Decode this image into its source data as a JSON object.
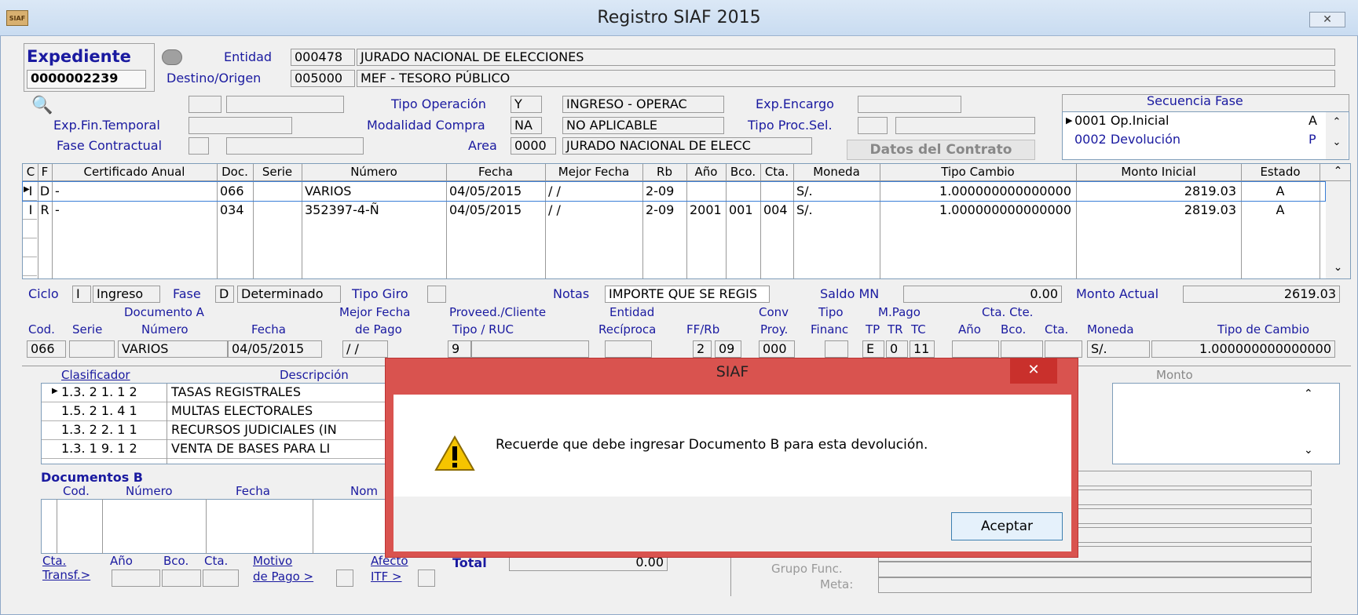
{
  "window": {
    "title": "Registro SIAF 2015",
    "icon_text": "SIAF",
    "close_glyph": "✕"
  },
  "expediente": {
    "label": "Expediente",
    "number": "0000002239"
  },
  "entidad": {
    "label": "Entidad",
    "code": "000478",
    "name": "JURADO NACIONAL DE ELECCIONES"
  },
  "destino": {
    "label": "Destino/Origen",
    "code": "005000",
    "name": "MEF - TESORO PÚBLICO"
  },
  "form": {
    "exp_fin_temporal": "Exp.Fin.Temporal",
    "fase_contractual": "Fase Contractual",
    "tipo_operacion_label": "Tipo Operación",
    "tipo_operacion_code": "Y",
    "tipo_operacion_text": "INGRESO - OPERAC",
    "modalidad_label": "Modalidad Compra",
    "modalidad_code": "NA",
    "modalidad_text": "NO APLICABLE",
    "area_label": "Area",
    "area_code": "0000",
    "area_text": "JURADO NACIONAL DE ELECC",
    "exp_encargo": "Exp.Encargo",
    "tipo_proc_sel": "Tipo Proc.Sel.",
    "datos_contrato": "Datos del Contrato"
  },
  "secuencia": {
    "title": "Secuencia Fase",
    "rows": [
      {
        "code": "0001",
        "name": "Op.Inicial",
        "st": "A"
      },
      {
        "code": "0002",
        "name": "Devolución",
        "st": "P"
      }
    ]
  },
  "grid": {
    "headers": [
      "C",
      "F",
      "Certificado Anual",
      "Doc.",
      "Serie",
      "Número",
      "Fecha",
      "Mejor Fecha",
      "Rb",
      "Año",
      "Bco.",
      "Cta.",
      "Moneda",
      "Tipo Cambio",
      "Monto Inicial",
      "Estado"
    ],
    "rows": [
      [
        "I",
        "D",
        "-",
        "066",
        "",
        "VARIOS",
        "04/05/2015",
        "/ /",
        "2-09",
        "",
        "",
        "",
        "S/.",
        "1.000000000000000",
        "2819.03",
        "A"
      ],
      [
        "I",
        "R",
        "-",
        "034",
        "",
        "352397-4-Ñ",
        "04/05/2015",
        "/ /",
        "2-09",
        "2001",
        "001",
        "004",
        "S/.",
        "1.000000000000000",
        "2819.03",
        "A"
      ]
    ]
  },
  "ciclo": {
    "ciclo_label": "Ciclo",
    "ciclo_code": "I",
    "ciclo_text": "Ingreso",
    "fase_label": "Fase",
    "fase_code": "D",
    "fase_text": "Determinado",
    "tipo_giro": "Tipo Giro",
    "notas_label": "Notas",
    "notas_text": "IMPORTE QUE SE REGIS",
    "saldo_label": "Saldo MN",
    "saldo_value": "0.00",
    "monto_label": "Monto Actual",
    "monto_value": "2619.03"
  },
  "docA": {
    "group_doc": "Documento A",
    "group_mejor": "Mejor Fecha",
    "mejor2": "de Pago",
    "group_prov": "Proveed./Cliente",
    "prov2": "Tipo / RUC",
    "group_ent": "Entidad",
    "ent2": "Recíproca",
    "ffrb": "FF/Rb",
    "conv": "Conv",
    "conv2": "Proy.",
    "tipo": "Tipo",
    "tipo2": "Financ",
    "mpago": "M.Pago",
    "tp": "TP",
    "tr": "TR",
    "tc": "TC",
    "ctacte": "Cta. Cte.",
    "anio": "Año",
    "bco": "Bco.",
    "cta": "Cta.",
    "moneda": "Moneda",
    "tcambio": "Tipo de Cambio",
    "cod": "Cod.",
    "serie": "Serie",
    "numero": "Número",
    "fecha": "Fecha",
    "v_cod": "066",
    "v_numero": "VARIOS",
    "v_fecha": "04/05/2015",
    "v_mejor": "/ /",
    "v_tipo": "9",
    "v_ff": "2",
    "v_rb": "09",
    "v_conv": "000",
    "v_tp": "E",
    "v_tr": "0",
    "v_tc": "11",
    "v_moneda": "S/.",
    "v_cambio": "1.000000000000000"
  },
  "clasif": {
    "h_clasif": "Clasificador",
    "h_desc": "Descripción",
    "h_monto": "Monto",
    "rows": [
      {
        "code": "1.3. 2 1. 1 2",
        "desc": "TASAS REGISTRALES"
      },
      {
        "code": "1.5. 2 1. 4 1",
        "desc": "MULTAS ELECTORALES"
      },
      {
        "code": "1.3. 2 2. 1 1",
        "desc": "RECURSOS JUDICIALES (IN"
      },
      {
        "code": "1.3. 1 9. 1 2",
        "desc": "VENTA DE BASES PARA LI"
      }
    ]
  },
  "docsB": {
    "title": "Documentos B",
    "cod": "Cod.",
    "numero": "Número",
    "fecha": "Fecha",
    "nom": "Nom",
    "cta": "Cta.",
    "transf": "Transf.>",
    "anio": "Año",
    "bco": "Bco.",
    "cta2": "Cta.",
    "motivo": "Motivo",
    "motivo2": "de Pago >",
    "afecto": "Afecto",
    "itf": "ITF >",
    "total_label": "Total",
    "total_value": "0.00",
    "grupo_func": "Grupo Func.",
    "meta": "Meta:"
  },
  "dialog": {
    "title": "SIAF",
    "close": "✕",
    "message": "Recuerde que debe ingresar Documento B para esta devolución.",
    "ok": "Aceptar"
  }
}
